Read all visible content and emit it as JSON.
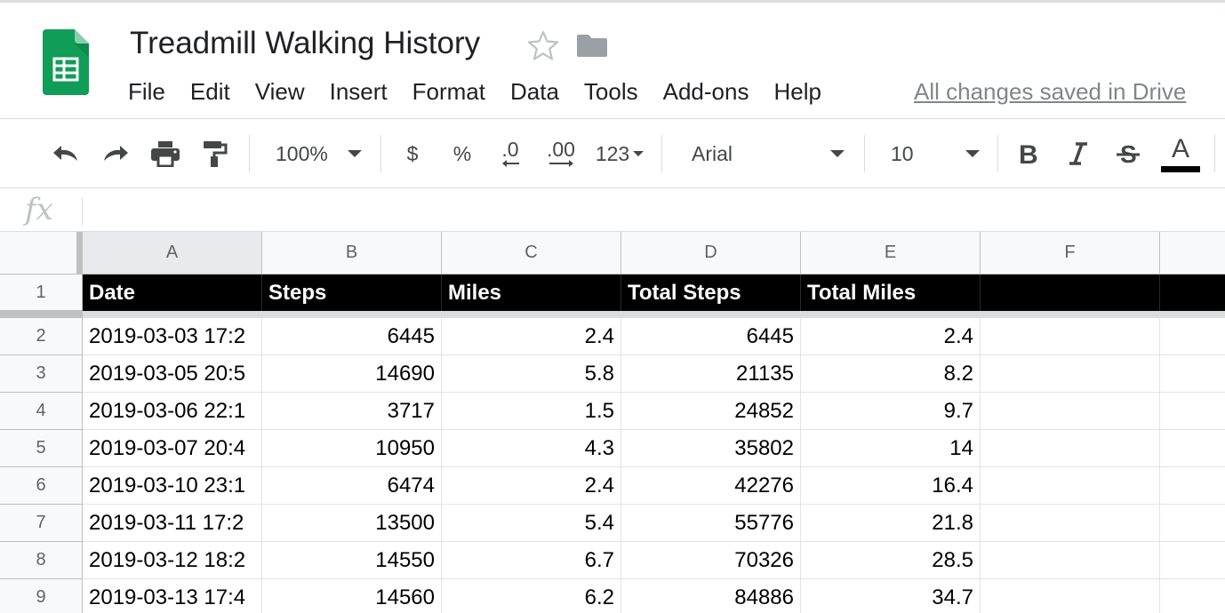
{
  "document": {
    "title": "Treadmill Walking History",
    "save_status": "All changes saved in Drive"
  },
  "menu": [
    "File",
    "Edit",
    "View",
    "Insert",
    "Format",
    "Data",
    "Tools",
    "Add-ons",
    "Help"
  ],
  "toolbar": {
    "zoom": "100%",
    "currency": "$",
    "percent": "%",
    "decrease_decimal": ".0",
    "increase_decimal": ".00",
    "more_formats": "123",
    "font": "Arial",
    "font_size": "10",
    "text_color_label": "A",
    "icons": [
      "undo-icon",
      "redo-icon",
      "print-icon",
      "paint-format-icon",
      "bold-icon",
      "italic-icon",
      "strikethrough-icon",
      "text-color-icon"
    ]
  },
  "formula_bar": {
    "label": "fx",
    "value": ""
  },
  "sheet": {
    "columns": [
      "A",
      "B",
      "C",
      "D",
      "E",
      "F"
    ],
    "rows": [
      "1",
      "2",
      "3",
      "4",
      "5",
      "6",
      "7",
      "8",
      "9"
    ],
    "header": [
      "Date",
      "Steps",
      "Miles",
      "Total Steps",
      "Total Miles",
      ""
    ],
    "data": [
      [
        "2019-03-03 17:2",
        "6445",
        "2.4",
        "6445",
        "2.4",
        ""
      ],
      [
        "2019-03-05 20:5",
        "14690",
        "5.8",
        "21135",
        "8.2",
        ""
      ],
      [
        "2019-03-06 22:1",
        "3717",
        "1.5",
        "24852",
        "9.7",
        ""
      ],
      [
        "2019-03-07 20:4",
        "10950",
        "4.3",
        "35802",
        "14",
        ""
      ],
      [
        "2019-03-10 23:1",
        "6474",
        "2.4",
        "42276",
        "16.4",
        ""
      ],
      [
        "2019-03-11 17:2",
        "13500",
        "5.4",
        "55776",
        "21.8",
        ""
      ],
      [
        "2019-03-12 18:2",
        "14550",
        "6.7",
        "70326",
        "28.5",
        ""
      ],
      [
        "2019-03-13 17:4",
        "14560",
        "6.2",
        "84886",
        "34.7",
        ""
      ]
    ]
  },
  "colors": {
    "sheets_green": "#0f9d58",
    "header_row_bg": "#000000",
    "header_row_text": "#ffffff",
    "selected_column_header": "#e8eaed"
  }
}
